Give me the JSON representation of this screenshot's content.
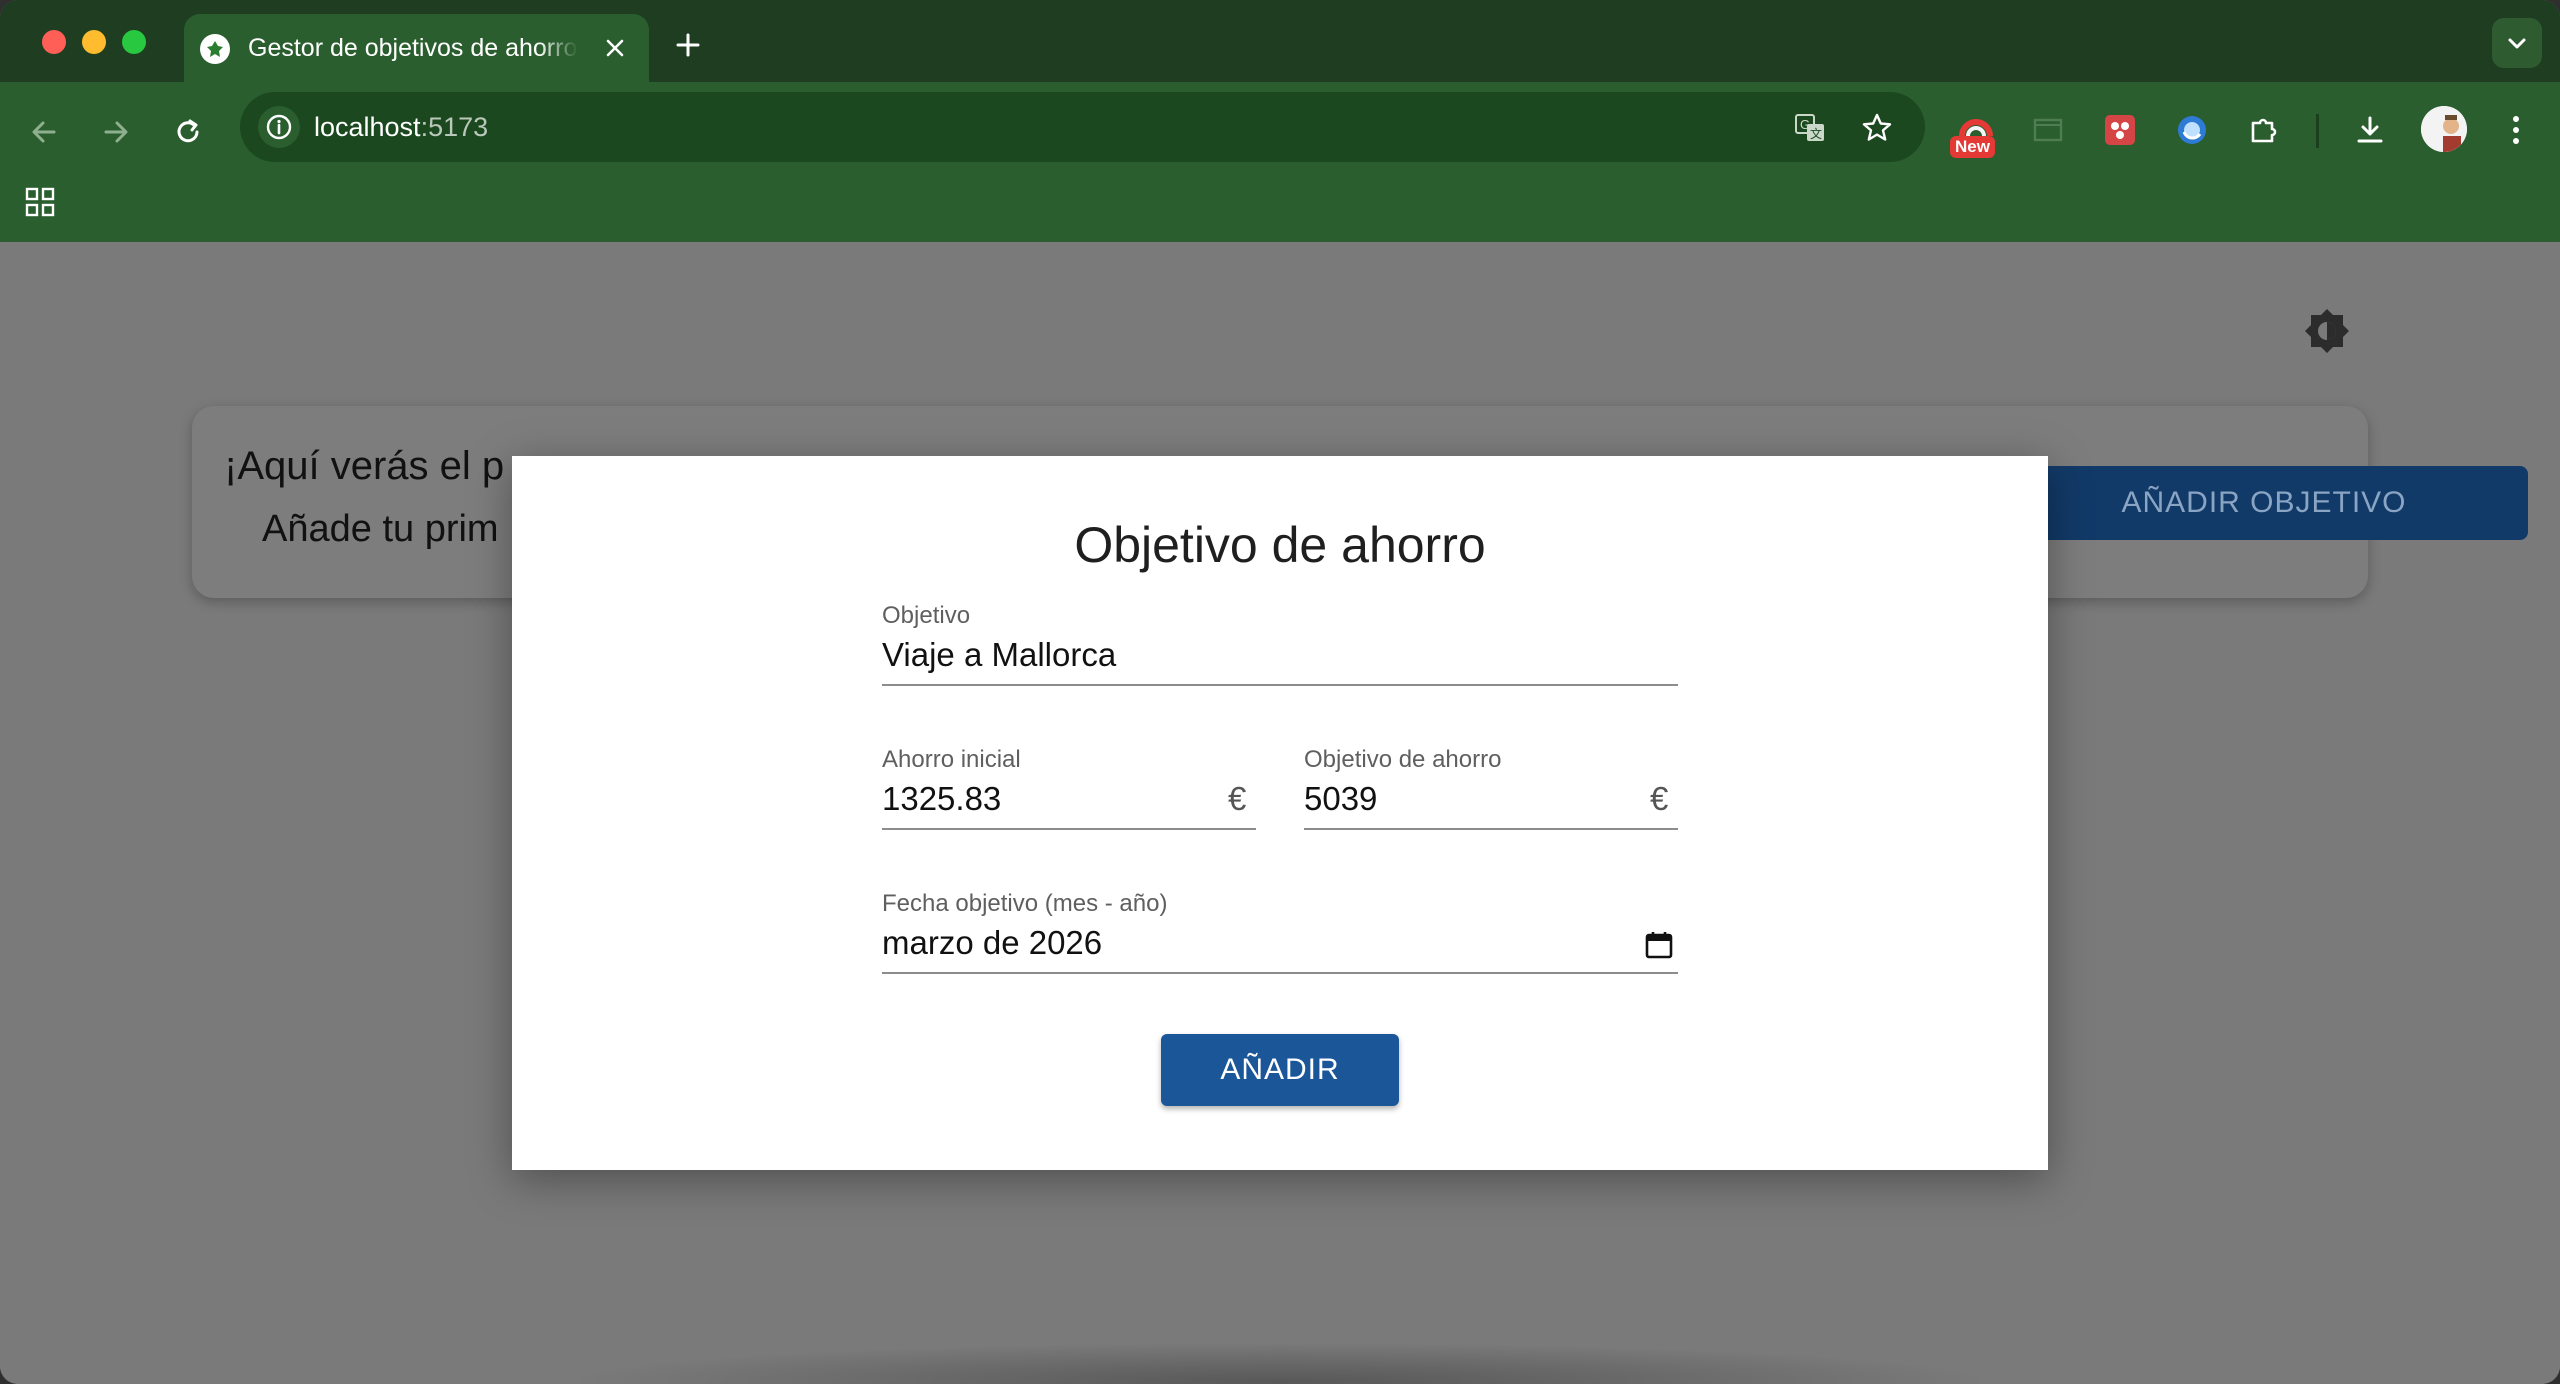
{
  "browser": {
    "tab_title": "Gestor de objetivos de ahorro",
    "url_host": "localhost",
    "url_port": ":5173",
    "extension_badge": "New",
    "colors": {
      "frame": "#1e3d21",
      "toolbar": "#2a5e2e",
      "omnibox": "#1c4820"
    }
  },
  "page": {
    "empty_card": {
      "title": "¡Aquí verás el p",
      "subtitle": "Añade tu prim",
      "add_button": "AÑADIR OBJETIVO"
    }
  },
  "modal": {
    "title": "Objetivo de ahorro",
    "fields": {
      "objetivo": {
        "label": "Objetivo",
        "value": "Viaje a Mallorca"
      },
      "ahorro_inicial": {
        "label": "Ahorro inicial",
        "value": "1325.83",
        "suffix": "€"
      },
      "objetivo_ahorro": {
        "label": "Objetivo de ahorro",
        "value": "5039",
        "suffix": "€"
      },
      "fecha": {
        "label": "Fecha objetivo (mes - año)",
        "value": "marzo de 2026"
      }
    },
    "submit_label": "AÑADIR",
    "colors": {
      "primary": "#1b5699"
    }
  },
  "icons": {
    "back": "arrow-left-icon",
    "forward": "arrow-right-icon",
    "reload": "reload-icon",
    "info": "info-icon",
    "translate": "translate-icon",
    "bookmark": "star-icon",
    "download": "download-icon",
    "menu": "kebab-menu-icon",
    "apps": "apps-grid-icon",
    "theme": "brightness-icon",
    "calendar": "calendar-icon"
  }
}
